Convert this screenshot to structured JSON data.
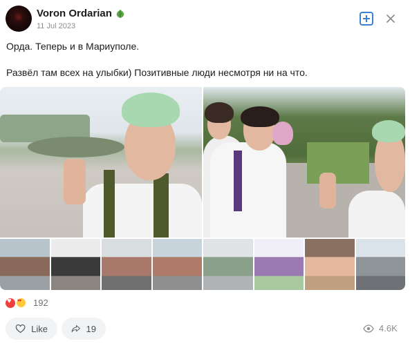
{
  "post": {
    "author": "Voron Ordarian",
    "date": "11 Jul 2023",
    "text_line1": "Орда. Теперь и в Мариуполе.",
    "text_line2": "Развёл там всех на улыбки) Позитивные люди несмотря ни на что."
  },
  "photos": {
    "main": [
      {
        "name": "selfie-square-photo"
      },
      {
        "name": "group-selfie-photo"
      }
    ],
    "thumbnails": [
      {
        "name": "thumb-apartment-building",
        "colors": [
          "#b8c4cc",
          "#8a6a5a",
          "#9aa0a4"
        ]
      },
      {
        "name": "thumb-building-entrance",
        "colors": [
          "#ececec",
          "#3a3a3a",
          "#8a8580"
        ]
      },
      {
        "name": "thumb-scaffold-building",
        "colors": [
          "#d8dde0",
          "#a8786a",
          "#707070"
        ]
      },
      {
        "name": "thumb-street-buildings",
        "colors": [
          "#c8d4dc",
          "#b07a68",
          "#8f8f8f"
        ]
      },
      {
        "name": "thumb-fence",
        "colors": [
          "#dfe3e6",
          "#8aa08a",
          "#b0b4b6"
        ]
      },
      {
        "name": "thumb-drawings",
        "colors": [
          "#f0eef6",
          "#9a7ab0",
          "#a8c8a0"
        ]
      },
      {
        "name": "thumb-group-photo",
        "colors": [
          "#8a7060",
          "#e4b89c",
          "#c0a080"
        ]
      },
      {
        "name": "thumb-square",
        "colors": [
          "#dbe3ea",
          "#8f9498",
          "#6e7276"
        ]
      }
    ]
  },
  "reactions": {
    "count": "192"
  },
  "actions": {
    "like_label": "Like",
    "share_count": "19"
  },
  "stats": {
    "views": "4.6K"
  },
  "colors": {
    "accent": "#3a80d4",
    "reaction_red": "#f03e3e",
    "reaction_yellow": "#ffc83d"
  }
}
